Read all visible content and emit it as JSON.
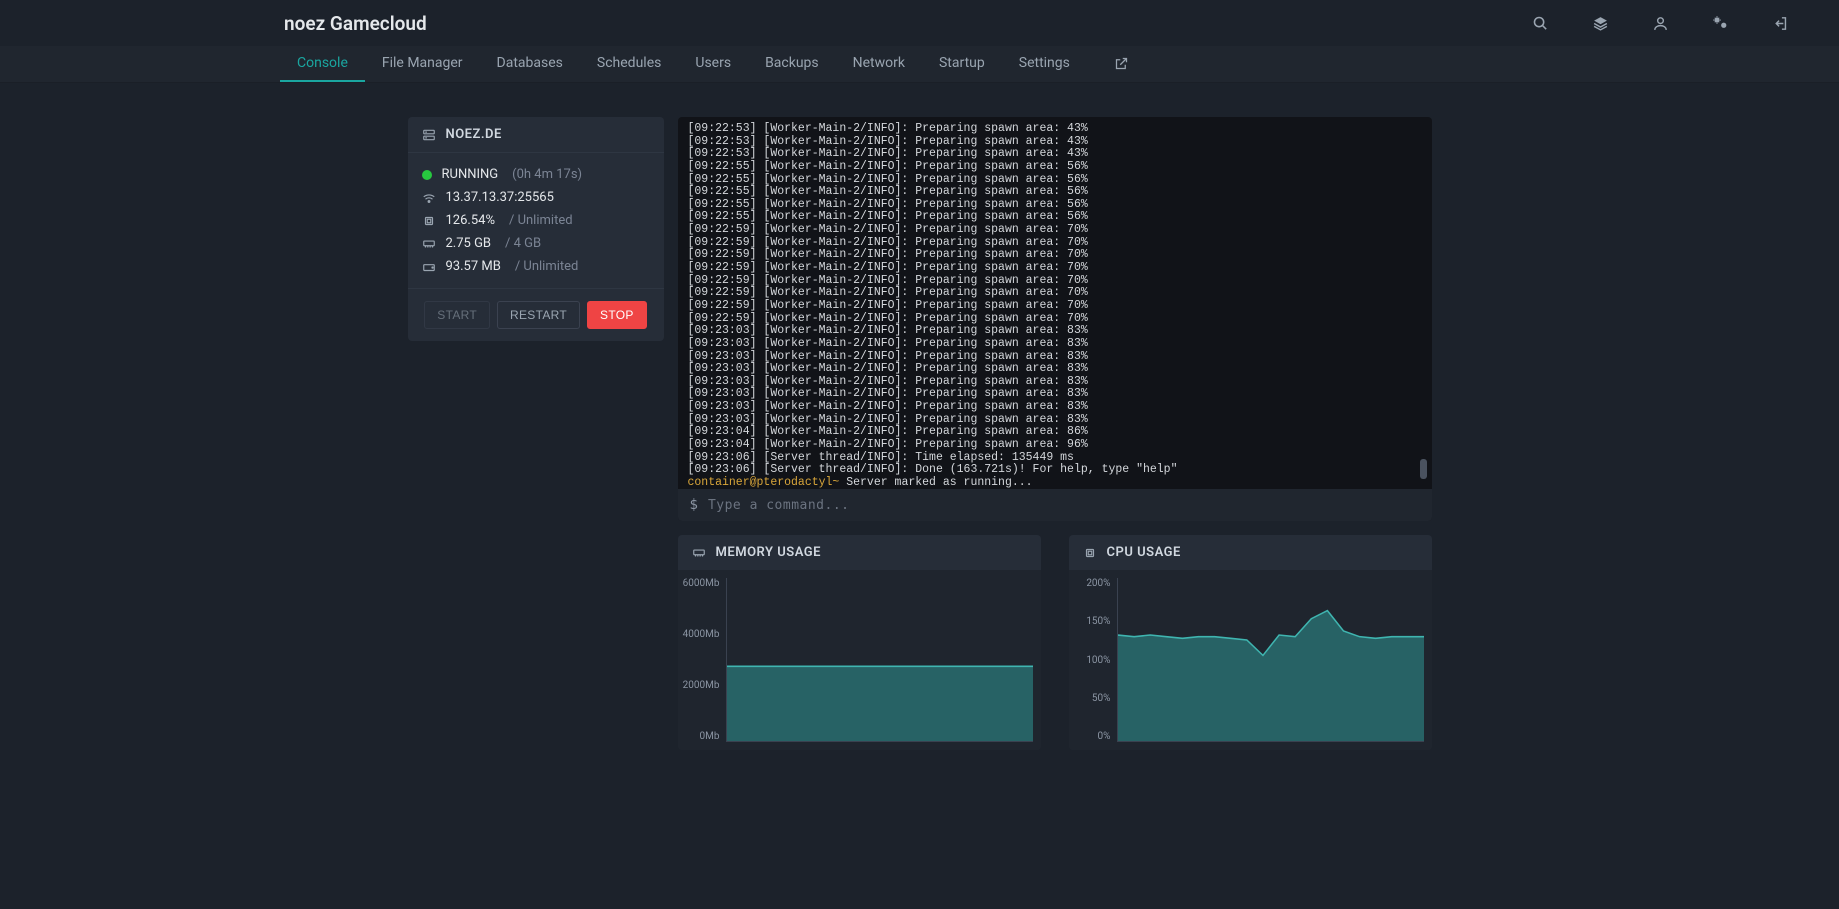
{
  "brand": "noez Gamecloud",
  "tabs": {
    "items": [
      {
        "label": "Console",
        "active": true
      },
      {
        "label": "File Manager"
      },
      {
        "label": "Databases"
      },
      {
        "label": "Schedules"
      },
      {
        "label": "Users"
      },
      {
        "label": "Backups"
      },
      {
        "label": "Network"
      },
      {
        "label": "Startup"
      },
      {
        "label": "Settings"
      }
    ]
  },
  "server": {
    "name_label": "NOEZ.DE",
    "status": "RUNNING",
    "uptime": "(0h 4m 17s)",
    "address": "13.37.13.37:25565",
    "cpu_value": "126.54%",
    "cpu_limit": "/ Unlimited",
    "mem_value": "2.75 GB",
    "mem_limit": "/ 4 GB",
    "disk_value": "93.57 MB",
    "disk_limit": "/ Unlimited"
  },
  "buttons": {
    "start": "START",
    "restart": "RESTART",
    "stop": "STOP"
  },
  "console": {
    "lines": [
      "[09:22:53] [Worker-Main-2/INFO]: Preparing spawn area: 43%",
      "[09:22:53] [Worker-Main-2/INFO]: Preparing spawn area: 43%",
      "[09:22:53] [Worker-Main-2/INFO]: Preparing spawn area: 43%",
      "[09:22:55] [Worker-Main-2/INFO]: Preparing spawn area: 56%",
      "[09:22:55] [Worker-Main-2/INFO]: Preparing spawn area: 56%",
      "[09:22:55] [Worker-Main-2/INFO]: Preparing spawn area: 56%",
      "[09:22:55] [Worker-Main-2/INFO]: Preparing spawn area: 56%",
      "[09:22:55] [Worker-Main-2/INFO]: Preparing spawn area: 56%",
      "[09:22:59] [Worker-Main-2/INFO]: Preparing spawn area: 70%",
      "[09:22:59] [Worker-Main-2/INFO]: Preparing spawn area: 70%",
      "[09:22:59] [Worker-Main-2/INFO]: Preparing spawn area: 70%",
      "[09:22:59] [Worker-Main-2/INFO]: Preparing spawn area: 70%",
      "[09:22:59] [Worker-Main-2/INFO]: Preparing spawn area: 70%",
      "[09:22:59] [Worker-Main-2/INFO]: Preparing spawn area: 70%",
      "[09:22:59] [Worker-Main-2/INFO]: Preparing spawn area: 70%",
      "[09:22:59] [Worker-Main-2/INFO]: Preparing spawn area: 70%",
      "[09:23:03] [Worker-Main-2/INFO]: Preparing spawn area: 83%",
      "[09:23:03] [Worker-Main-2/INFO]: Preparing spawn area: 83%",
      "[09:23:03] [Worker-Main-2/INFO]: Preparing spawn area: 83%",
      "[09:23:03] [Worker-Main-2/INFO]: Preparing spawn area: 83%",
      "[09:23:03] [Worker-Main-2/INFO]: Preparing spawn area: 83%",
      "[09:23:03] [Worker-Main-2/INFO]: Preparing spawn area: 83%",
      "[09:23:03] [Worker-Main-2/INFO]: Preparing spawn area: 83%",
      "[09:23:03] [Worker-Main-2/INFO]: Preparing spawn area: 83%",
      "[09:23:04] [Worker-Main-2/INFO]: Preparing spawn area: 86%",
      "[09:23:04] [Worker-Main-2/INFO]: Preparing spawn area: 96%",
      "[09:23:06] [Server thread/INFO]: Time elapsed: 135449 ms",
      "[09:23:06] [Server thread/INFO]: Done (163.721s)! For help, type \"help\""
    ],
    "prompt_prefix": "container@pterodactyl~",
    "prompt_msg": " Server marked as running...",
    "input_placeholder": "Type a command..."
  },
  "charts": {
    "memory_title": "MEMORY USAGE",
    "cpu_title": "CPU USAGE"
  },
  "chart_data": [
    {
      "type": "area",
      "title": "MEMORY USAGE",
      "ylabel": "Mb",
      "ylim": [
        0,
        6000
      ],
      "yticks": [
        "6000Mb",
        "4000Mb",
        "2000Mb",
        "0Mb"
      ],
      "x": [
        0,
        1,
        2,
        3,
        4,
        5,
        6,
        7,
        8,
        9,
        10,
        11,
        12,
        13,
        14,
        15,
        16,
        17,
        18,
        19
      ],
      "values": [
        2750,
        2750,
        2750,
        2750,
        2750,
        2750,
        2750,
        2750,
        2750,
        2750,
        2750,
        2750,
        2750,
        2750,
        2750,
        2750,
        2750,
        2750,
        2750,
        2750
      ]
    },
    {
      "type": "area",
      "title": "CPU USAGE",
      "ylabel": "%",
      "ylim": [
        0,
        200
      ],
      "yticks": [
        "200%",
        "150%",
        "100%",
        "50%",
        "0%"
      ],
      "x": [
        0,
        1,
        2,
        3,
        4,
        5,
        6,
        7,
        8,
        9,
        10,
        11,
        12,
        13,
        14,
        15,
        16,
        17,
        18,
        19
      ],
      "values": [
        130,
        128,
        130,
        128,
        126,
        128,
        128,
        126,
        124,
        105,
        130,
        128,
        150,
        160,
        135,
        128,
        126,
        128,
        128,
        128
      ]
    }
  ]
}
